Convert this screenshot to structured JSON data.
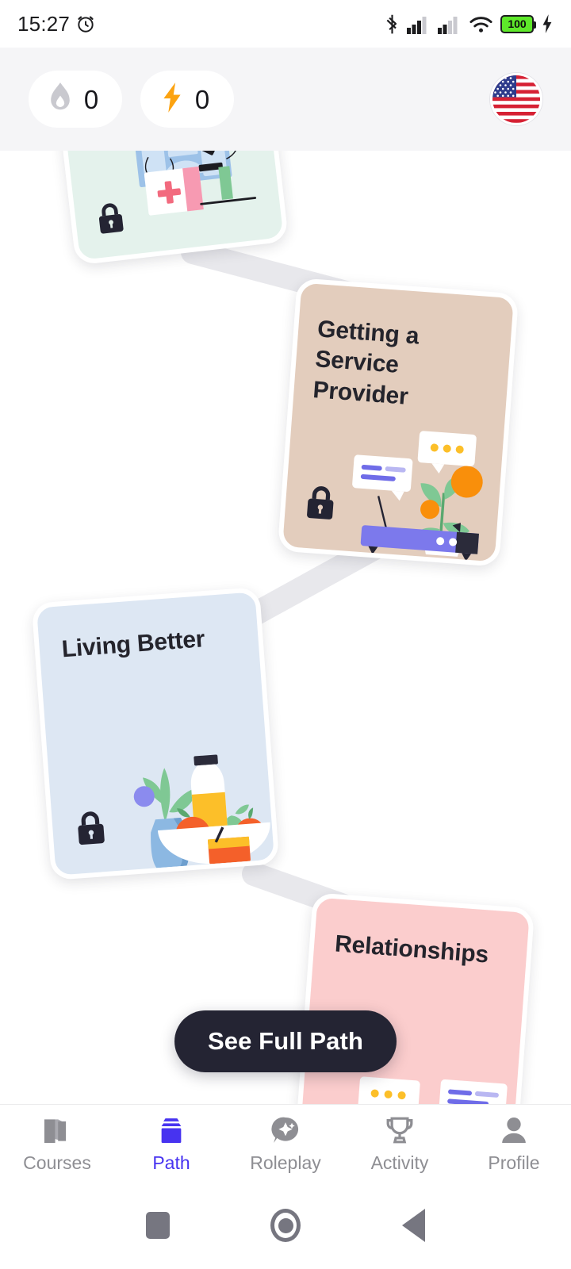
{
  "status_bar": {
    "time": "15:27",
    "alarm_icon": "alarm-clock-icon",
    "bluetooth_icon": "bluetooth-icon",
    "signal_1_icon": "cellular-signal-icon",
    "signal_2_icon": "cellular-signal-icon",
    "wifi_icon": "wifi-icon",
    "battery_level": "100",
    "charging_icon": "charging-bolt-icon"
  },
  "header": {
    "streak_chip": {
      "icon": "flame-icon",
      "value": "0"
    },
    "energy_chip": {
      "icon": "lightning-bolt-icon",
      "value": "0"
    },
    "avatar": {
      "icon": "us-flag-avatar",
      "label": ""
    }
  },
  "path": {
    "cards": [
      {
        "id": "healthcare",
        "title": "",
        "locked": true,
        "lock_icon": "padlock-locked-icon",
        "bg_color": "#e4f2ec",
        "art": "medical-xray-first-aid-microscope-illustration"
      },
      {
        "id": "service-provider",
        "title": "Getting a Service Provider",
        "locked": true,
        "lock_icon": "padlock-locked-icon",
        "bg_color": "#e3cdbd",
        "art": "chat-bubbles-plant-bench-illustration"
      },
      {
        "id": "living-better",
        "title": "Living Better",
        "locked": true,
        "lock_icon": "padlock-locked-icon",
        "bg_color": "#dde7f3",
        "art": "vase-plant-fruit-bowl-bottle-illustration"
      },
      {
        "id": "relationships",
        "title": "Relationships",
        "locked": true,
        "lock_icon": "padlock-locked-icon",
        "bg_color": "#fbcdcd",
        "art": "chat-bubbles-two-birds-illustration"
      }
    ],
    "connector_color": "#e8e8ec"
  },
  "see_full_path_button": {
    "label": "See Full Path"
  },
  "bottom_nav": {
    "active_color": "#4733f0",
    "inactive_color": "#8e8e93",
    "items": [
      {
        "label": "Courses",
        "icon": "book-icon",
        "active": false
      },
      {
        "label": "Path",
        "icon": "layers-stack-icon",
        "active": true
      },
      {
        "label": "Roleplay",
        "icon": "chat-sparkle-icon",
        "active": false
      },
      {
        "label": "Activity",
        "icon": "trophy-icon",
        "active": false
      },
      {
        "label": "Profile",
        "icon": "person-icon",
        "active": false
      }
    ]
  },
  "system_nav": {
    "recents_icon": "square-recents-icon",
    "home_icon": "circle-home-icon",
    "back_icon": "triangle-back-icon"
  }
}
